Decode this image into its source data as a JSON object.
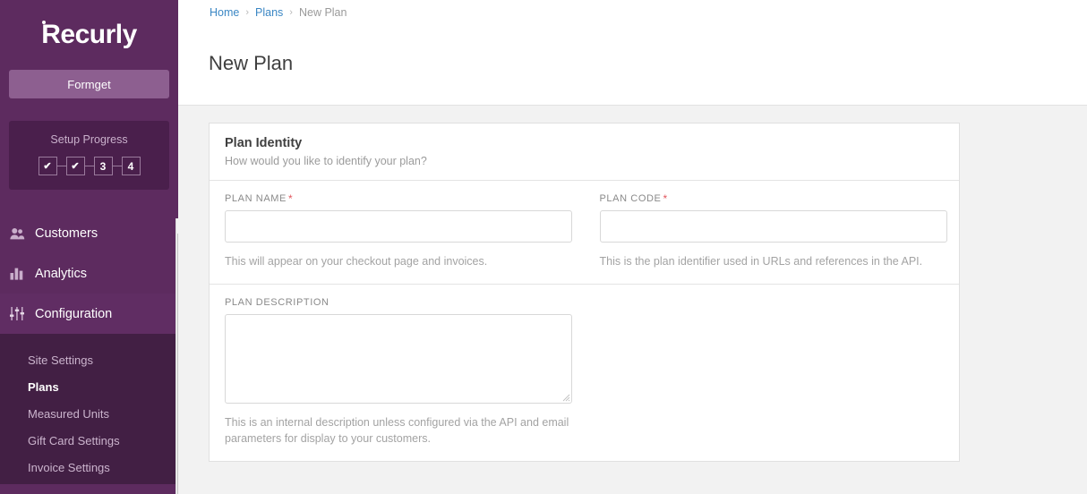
{
  "sidebar": {
    "brand": {
      "logo_text": "Recurly",
      "logo_icon": "recurly-logo"
    },
    "account_button": "Formget",
    "setup": {
      "title": "Setup Progress",
      "steps": [
        {
          "label": "✔",
          "state": "done"
        },
        {
          "label": "✔",
          "state": "done"
        },
        {
          "label": "3",
          "state": "pending"
        },
        {
          "label": "4",
          "state": "pending"
        }
      ]
    },
    "nav": [
      {
        "label": "Customers",
        "icon": "users-icon",
        "active": false
      },
      {
        "label": "Analytics",
        "icon": "bar-chart-icon",
        "active": false
      },
      {
        "label": "Configuration",
        "icon": "sliders-icon",
        "active": true
      }
    ],
    "submenu": [
      {
        "label": "Site Settings",
        "active": false
      },
      {
        "label": "Plans",
        "active": true
      },
      {
        "label": "Measured Units",
        "active": false
      },
      {
        "label": "Gift Card Settings",
        "active": false
      },
      {
        "label": "Invoice Settings",
        "active": false
      }
    ]
  },
  "header": {
    "breadcrumb": [
      {
        "label": "Home",
        "link": true
      },
      {
        "label": "Plans",
        "link": true
      },
      {
        "label": "New Plan",
        "link": false
      }
    ],
    "breadcrumb_separator": "›",
    "page_title": "New Plan"
  },
  "card": {
    "title": "Plan Identity",
    "subtitle": "How would you like to identify your plan?",
    "fields": {
      "plan_name": {
        "label": "PLAN NAME",
        "required_mark": "*",
        "value": "",
        "placeholder": "",
        "help": "This will appear on your checkout page and invoices."
      },
      "plan_code": {
        "label": "PLAN CODE",
        "required_mark": "*",
        "value": "",
        "placeholder": "",
        "help": "This is the plan identifier used in URLs and references in the API."
      },
      "plan_description": {
        "label": "PLAN DESCRIPTION",
        "value": "",
        "placeholder": "",
        "help": "This is an internal description unless configured via the API and email parameters for display to your customers."
      }
    }
  },
  "colors": {
    "sidebar_bg": "#5d2b5f",
    "sidebar_active": "#602d63",
    "submenu_bg": "#421f44",
    "setup_box_bg": "#4a1f4c",
    "account_btn": "#8d5f90",
    "link_blue": "#3b87c4",
    "required_red": "#e2575e",
    "page_bg": "#f2f2f2"
  }
}
